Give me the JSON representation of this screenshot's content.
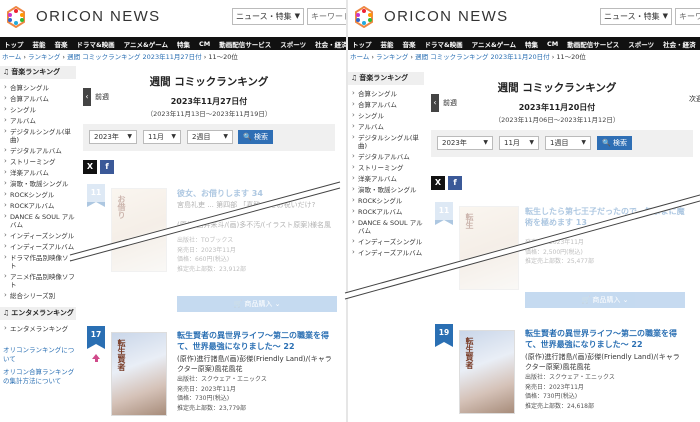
{
  "header": {
    "brand": "ORICON NEWS",
    "select_label": "ニュース・特集",
    "search_placeholder": "キーワード"
  },
  "nav": [
    "トップ",
    "芸能",
    "音楽",
    "ドラマ&映画",
    "アニメ&ゲーム",
    "特集",
    "CM",
    "動画配信サービス",
    "スポーツ",
    "社会・経済"
  ],
  "sidebar": {
    "heading": "音楽ランキング",
    "items": [
      "合算シングル",
      "合算アルバム",
      "シングル",
      "アルバム",
      "デジタルシングル(単曲)",
      "デジタルアルバム",
      "ストリーミング",
      "洋楽アルバム",
      "演歌・歌謡シングル",
      "ROCKシングル",
      "ROCKアルバム",
      "DANCE & SOUL アルバム",
      "インディーズシングル",
      "インディーズアルバム",
      "ドラマ作品別映像ソフト",
      "アニメ作品別映像ソフト",
      "総合シリーズ別"
    ],
    "heading2": "エンタメランキング",
    "items2": [
      "エンタメランキング"
    ],
    "links": [
      "オリコンランキングについて",
      "オリコン合算ランキングの集計方法について"
    ]
  },
  "left": {
    "breadcrumb_home": "ホーム",
    "breadcrumb_ranking": "ランキング",
    "breadcrumb_current": "週間 コミックランキング 2023年11月27日付",
    "breadcrumb_range": "11〜20位",
    "title": "週間 コミックランキング",
    "date": "2023年11月27日付",
    "range": "（2023年11月13日〜2023年11月19日）",
    "prev": "前週",
    "filter_year": "2023年",
    "filter_month": "11月",
    "filter_week": "2週目",
    "search_button": "検索",
    "card1": {
      "rank": "11",
      "cover_text": "お借り",
      "title": "彼女、お借りします 34",
      "author": "宮島礼吏 ... 第四部 「喜歓」 をお祝いだけ?",
      "author2": "(原作)西井米斗/(画)多不汚/(イラスト原案)様名風",
      "publisher": "出版社：TOブックス",
      "release": "発売日：2023年11月",
      "price": "価格：660円(税込)",
      "sales": "推定売上部数：23,912部",
      "buy": "商品購入"
    },
    "card2": {
      "rank": "17",
      "cover_text": "転生賢者",
      "title": "転生賢者の異世界ライフ〜第二の職業を得て、世界最強になりました〜 22",
      "author": "(原作)進行諸島/(画)彭傑(Friendly Land)/(キャラクター原案)風花風花",
      "publisher": "出版社：スクウェア・エニックス",
      "release": "発売日：2023年11月",
      "price": "価格：730円(税込)",
      "sales": "推定売上部数：23,779部"
    }
  },
  "right": {
    "breadcrumb_home": "ホーム",
    "breadcrumb_ranking": "ランキング",
    "breadcrumb_current": "週間 コミックランキング 2023年11月20日付",
    "breadcrumb_range": "11〜20位",
    "title": "週間 コミックランキング",
    "date": "2023年11月20日付",
    "range": "（2023年11月06日〜2023年11月12日）",
    "prev": "前週",
    "next": "次週",
    "filter_year": "2023年",
    "filter_month": "11月",
    "filter_week": "1週目",
    "search_button": "検索",
    "card1": {
      "rank": "11",
      "cover_text": "転生",
      "title": "転生したら第七王子だったので、気ままに魔術を極めます 13",
      "release": "発売日：2023年11月",
      "price": "価格：2,500円(税込)",
      "sales": "推定売上部数：25,477部",
      "buy": "商品購入"
    },
    "card2": {
      "rank": "19",
      "cover_text": "転生賢者",
      "title": "転生賢者の異世界ライフ〜第二の職業を得て、世界最強になりました〜 22",
      "author": "(原作)進行諸島/(画)彭傑(Friendly Land)/(キャラクター原案)風花風花",
      "publisher": "出版社：スクウェア・エニックス",
      "release": "発売日：2023年11月",
      "price": "価格：730円(税込)",
      "sales": "推定売上部数：24,618部"
    }
  },
  "colors": {
    "accent": "#2a6fb3",
    "nav_bg": "#111111",
    "filter_bg": "#f0f0f0",
    "button": "#2f6fb5",
    "buy_button": "#6a9fd8",
    "facebook": "#3b5998"
  },
  "icons": [
    "oricon-logo-icon",
    "music-note-icon",
    "chevron-left-icon",
    "x-social-icon",
    "facebook-icon",
    "cart-icon",
    "rank-up-arrow-icon"
  ]
}
